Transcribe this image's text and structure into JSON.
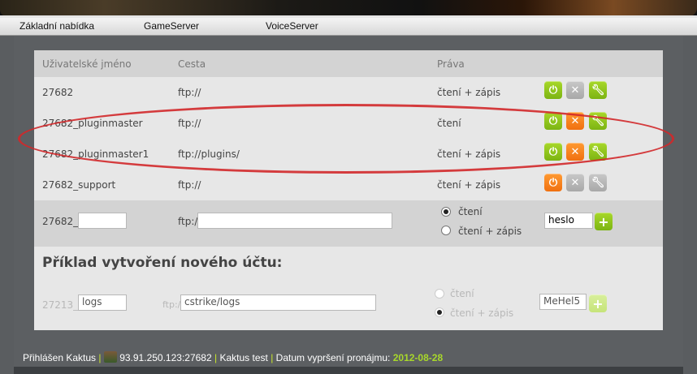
{
  "nav": {
    "items": [
      "Základní nabídka",
      "GameServer",
      "VoiceServer"
    ]
  },
  "table": {
    "headers": {
      "username": "Uživatelské jméno",
      "path": "Cesta",
      "rights": "Práva"
    },
    "rows": [
      {
        "username": "27682",
        "path": "ftp://",
        "rights": "čtení + zápis"
      },
      {
        "username": "27682_pluginmaster",
        "path": "ftp://",
        "rights": "čtení"
      },
      {
        "username": "27682_pluginmaster1",
        "path": "ftp://plugins/",
        "rights": "čtení + zápis"
      },
      {
        "username": "27682_support",
        "path": "ftp://",
        "rights": "čtení + zápis"
      }
    ]
  },
  "add_form": {
    "username_prefix": "27682_",
    "path_prefix": "ftp://",
    "rights_read": "čtení",
    "rights_readwrite": "čtení + zápis",
    "password_value": "heslo",
    "add_label": "+"
  },
  "example": {
    "title": "Příklad vytvoření nového účtu:",
    "username_prefix": "27213_",
    "username_value": "logs",
    "path_prefix": "ftp://",
    "path_value": "cstrike/logs",
    "rights_read": "čtení",
    "rights_readwrite": "čtení + zápis",
    "password_value": "MeHel5",
    "add_label": "+"
  },
  "status": {
    "logged_in": "Přihlášen Kaktus",
    "separator": "|",
    "server": "93.91.250.123:27682",
    "user": "Kaktus test",
    "lease_label": "Datum vypršení pronájmu:",
    "lease_date": "2012-08-28"
  },
  "icons": {
    "enable": "power-icon",
    "delete": "close-icon",
    "edit": "wrench-icon",
    "avatar": "avatar-icon"
  },
  "colors": {
    "green": "#8cc41a",
    "orange": "#f5821f",
    "gray": "#b4b4b4",
    "highlight": "#d2282a"
  }
}
